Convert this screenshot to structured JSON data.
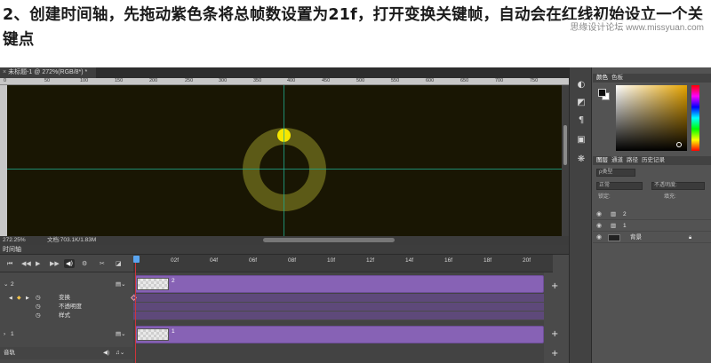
{
  "instruction": {
    "text": "2、创建时间轴，先拖动紫色条将总帧数设置为21f，打开变换关键帧，自动会在红线初始设立一个关键点",
    "watermark": "思缘设计论坛 www.missyuan.com"
  },
  "document": {
    "tab_title": "未标题-1 @ 272%(RGB/8*) *",
    "ruler_ticks": [
      "0",
      "50",
      "100",
      "150",
      "200",
      "250",
      "300",
      "350",
      "400",
      "450",
      "500",
      "550",
      "600",
      "650",
      "700",
      "750"
    ],
    "zoom": "272.25%",
    "doc_info": "文档:703.1K/1.83M"
  },
  "canvas": {
    "background_color": "#191603",
    "ring_color": "#5c5a17",
    "dot_color": "#f5e600",
    "guide_color": "#1fa98c"
  },
  "timeline": {
    "panel_title": "时间轴",
    "frame_ticks": [
      "02f",
      "04f",
      "06f",
      "08f",
      "10f",
      "12f",
      "14f",
      "16f",
      "18f",
      "20f"
    ],
    "total_frames": 21,
    "layers": [
      {
        "name": "2",
        "properties": [
          "变换",
          "不透明度",
          "样式"
        ],
        "clip_label": "2"
      },
      {
        "name": "1",
        "clip_label": "1"
      }
    ],
    "audio_track_label": "音轨",
    "clip_color": "#8762b5",
    "playhead_color": "#d0343a"
  },
  "color_panel": {
    "tabs": [
      "颜色",
      "色板"
    ],
    "foreground": "#0d0d0d",
    "background": "#ffffff"
  },
  "layers_panel": {
    "tabs": [
      "图层",
      "通道",
      "路径",
      "历史记录"
    ],
    "filter_label": "ρ类型",
    "blend_mode": "正常",
    "opacity_label": "不透明度:",
    "lock_label": "锁定:",
    "fill_label": "填充:",
    "layers": [
      {
        "name": "2"
      },
      {
        "name": "1"
      },
      {
        "name": "背景"
      }
    ]
  }
}
